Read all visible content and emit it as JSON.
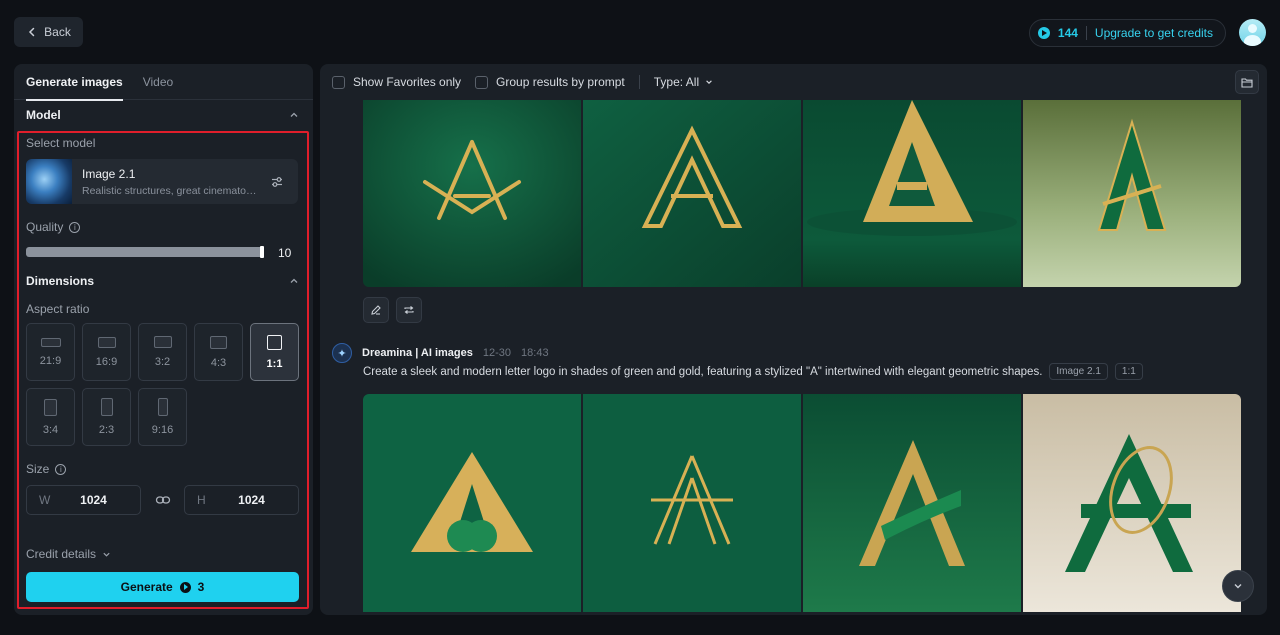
{
  "topbar": {
    "back_label": "Back",
    "credits_count": "144",
    "upgrade_label": "Upgrade to get credits"
  },
  "left_panel": {
    "tabs": [
      {
        "label": "Generate images",
        "active": true
      },
      {
        "label": "Video",
        "active": false
      }
    ],
    "model_section_title": "Model",
    "select_model_label": "Select model",
    "model": {
      "name": "Image 2.1",
      "description": "Realistic structures, great cinematog..."
    },
    "quality_label": "Quality",
    "quality_value": "10",
    "quality_fraction": 1.0,
    "dimensions_section_title": "Dimensions",
    "aspect_ratio_label": "Aspect ratio",
    "aspect_ratios": [
      {
        "label": "21:9",
        "selected": false
      },
      {
        "label": "16:9",
        "selected": false
      },
      {
        "label": "3:2",
        "selected": false
      },
      {
        "label": "4:3",
        "selected": false
      },
      {
        "label": "1:1",
        "selected": true
      },
      {
        "label": "3:4",
        "selected": false
      },
      {
        "label": "2:3",
        "selected": false
      },
      {
        "label": "9:16",
        "selected": false
      }
    ],
    "size_label": "Size",
    "width_prefix": "W",
    "width_value": "1024",
    "height_prefix": "H",
    "height_value": "1024",
    "credit_details_label": "Credit details",
    "generate_label": "Generate",
    "generate_cost": "3"
  },
  "right_panel": {
    "show_favorites_label": "Show Favorites only",
    "group_by_prompt_label": "Group results by prompt",
    "type_filter_label": "Type: All",
    "generation": {
      "author": "Dreamina | AI images",
      "date": "12-30",
      "time": "18:43",
      "prompt": "Create a sleek and modern letter logo in shades of green and gold, featuring a stylized \"A\" intertwined with elegant geometric shapes.",
      "model_tag": "Image 2.1",
      "ratio_tag": "1:1"
    }
  },
  "colors": {
    "accent": "#1fd1ef",
    "highlight_border": "#e01e2b",
    "panel_bg": "#1b2027",
    "page_bg": "#0e1116"
  }
}
